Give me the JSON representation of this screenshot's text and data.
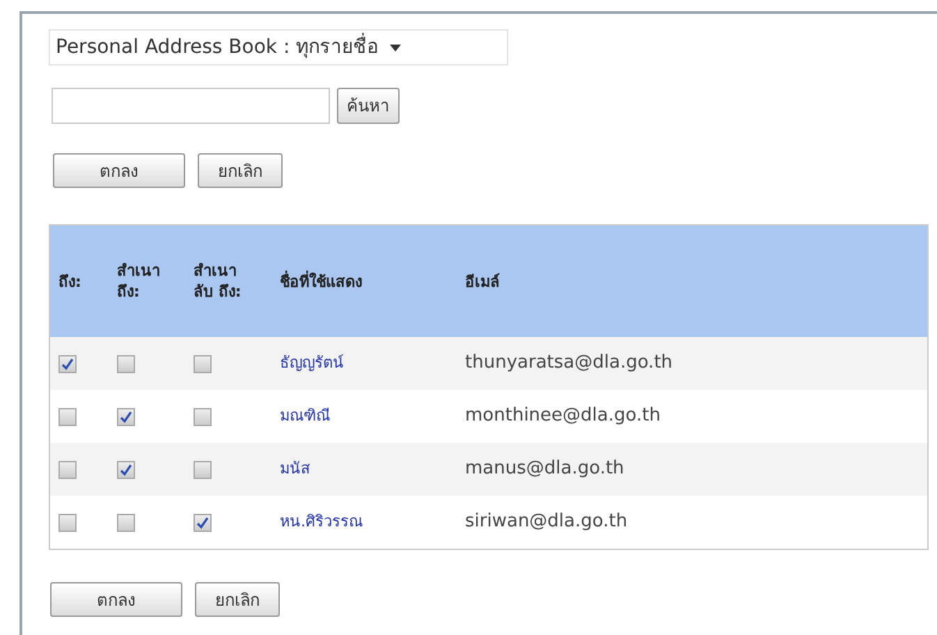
{
  "address_book": {
    "value": "Personal Address Book : ทุกรายชื่อ"
  },
  "search": {
    "button": "ค้นหา"
  },
  "top_buttons": [
    "ตกลง",
    "ยกเลิก"
  ],
  "table": {
    "columns": [
      "ถึง:",
      "สำเนา ถึง:",
      "สำเนา ลับ ถึง:",
      "ชื่อที่ใช้แสดง",
      "อีเมล์"
    ],
    "rows": [
      {
        "to": true,
        "cc": false,
        "bcc": false,
        "name": "ธัญญรัตน์",
        "email": "thunyaratsa@dla.go.th"
      },
      {
        "to": false,
        "cc": true,
        "bcc": false,
        "name": "มณฑิณี",
        "email": "monthinee@dla.go.th"
      },
      {
        "to": false,
        "cc": true,
        "bcc": false,
        "name": "มนัส",
        "email": "manus@dla.go.th"
      },
      {
        "to": false,
        "cc": false,
        "bcc": true,
        "name": "หน.ศิริวรรณ",
        "email": "siriwan@dla.go.th"
      }
    ]
  },
  "bottom_buttons": [
    "ตกลง",
    "ยกเลิก"
  ]
}
